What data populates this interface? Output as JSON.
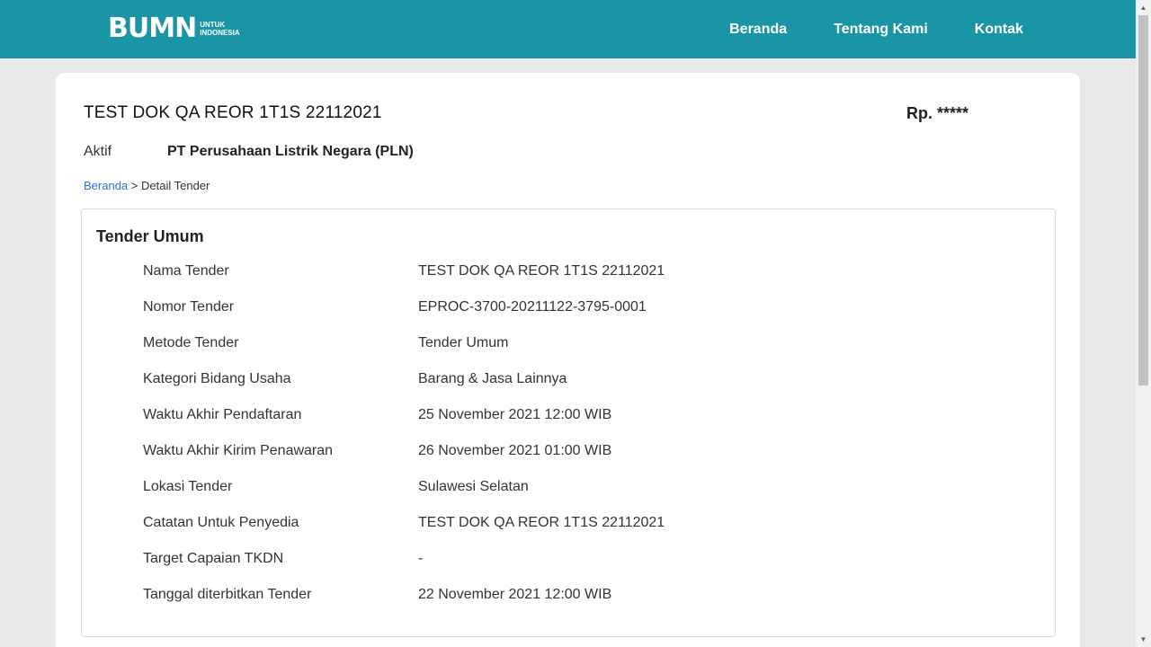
{
  "header": {
    "logo_main": "BUMN",
    "logo_sub_line1": "UNTUK",
    "logo_sub_line2": "INDONESIA",
    "nav": [
      "Beranda",
      "Tentang Kami",
      "Kontak"
    ]
  },
  "tender": {
    "title": "TEST DOK QA REOR 1T1S 22112021",
    "price": "Rp. *****",
    "status": "Aktif",
    "company": "PT Perusahaan Listrik Negara (PLN)"
  },
  "breadcrumb": {
    "home": "Beranda",
    "separator": ">",
    "current": "Detail Tender"
  },
  "panel": {
    "title": "Tender Umum",
    "rows": [
      {
        "label": "Nama Tender",
        "value": "TEST DOK QA REOR 1T1S 22112021"
      },
      {
        "label": "Nomor Tender",
        "value": "EPROC-3700-20211122-3795-0001"
      },
      {
        "label": "Metode Tender",
        "value": "Tender Umum"
      },
      {
        "label": "Kategori Bidang Usaha",
        "value": "Barang & Jasa Lainnya"
      },
      {
        "label": "Waktu Akhir Pendaftaran",
        "value": "25 November 2021 12:00 WIB"
      },
      {
        "label": "Waktu Akhir Kirim Penawaran",
        "value": "26 November 2021 01:00 WIB"
      },
      {
        "label": "Lokasi Tender",
        "value": "Sulawesi Selatan"
      },
      {
        "label": "Catatan Untuk Penyedia",
        "value": "TEST DOK QA REOR 1T1S 22112021"
      },
      {
        "label": "Target Capaian TKDN",
        "value": "-"
      },
      {
        "label": "Tanggal diterbitkan Tender",
        "value": "22 November 2021 12:00 WIB"
      }
    ]
  },
  "colors": {
    "header_bg": "#1a95a6",
    "page_bg": "#e9e9ea",
    "link": "#2c6fd6"
  }
}
